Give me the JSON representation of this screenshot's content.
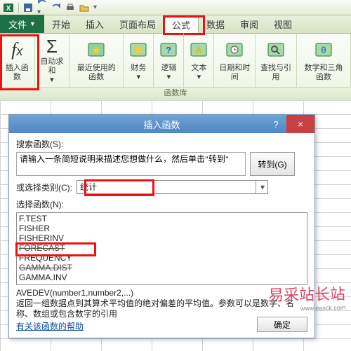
{
  "qat": {
    "items": [
      "excel",
      "save",
      "undo",
      "redo",
      "print",
      "open"
    ]
  },
  "tabs": {
    "file": "文件",
    "items": [
      "开始",
      "插入",
      "页面布局",
      "公式",
      "数据",
      "审阅",
      "视图"
    ],
    "active_index": 3
  },
  "ribbon": {
    "groups": [
      {
        "label": "插入函数",
        "icon": "fx"
      },
      {
        "label": "自动求和",
        "icon": "sigma"
      },
      {
        "label": "最近使用的函数",
        "icon": "book-star"
      },
      {
        "label": "财务",
        "icon": "book-money"
      },
      {
        "label": "逻辑",
        "icon": "book-q"
      },
      {
        "label": "文本",
        "icon": "book-a"
      },
      {
        "label": "日期和时间",
        "icon": "book-clock"
      },
      {
        "label": "查找与引用",
        "icon": "book-search"
      },
      {
        "label": "数学和三角函数",
        "icon": "book-theta"
      }
    ],
    "section_label": "函数库"
  },
  "dialog": {
    "title": "插入函数",
    "close": "×",
    "help_btn": "?",
    "search_label": "搜索函数(S):",
    "search_value": "请输入一条简短说明来描述您想做什么，然后单击\"转到\"",
    "go_btn": "转到(G)",
    "category_label": "或选择类别(C):",
    "category_value": "统计",
    "selectfn_label": "选择函数(N):",
    "functions": [
      "F.TEST",
      "FISHER",
      "FISHERINV",
      "FORECAST",
      "FREQUENCY",
      "GAMMA.DIST",
      "GAMMA.INV"
    ],
    "sig": "AVEDEV(number1,number2,...)",
    "desc": "返回一组数据点到其算术平均值的绝对偏差的平均值。参数可以是数字、名称、数组或包含数字的引用",
    "help_link": "有关该函数的帮助",
    "ok_btn": "确定"
  },
  "watermark": {
    "main": "易采站长站",
    "sub": "www.easck.com"
  }
}
